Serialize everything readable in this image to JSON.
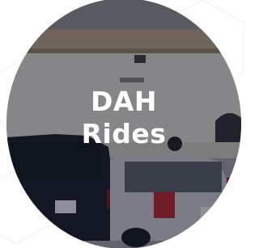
{
  "card": {
    "title_line1": "DAH",
    "title_line2": "Rides"
  },
  "colors": {
    "background": "#ffffff",
    "overlay": "#1a1e2e",
    "text": "#ffffff",
    "pattern_stroke": "#eef0f3"
  }
}
